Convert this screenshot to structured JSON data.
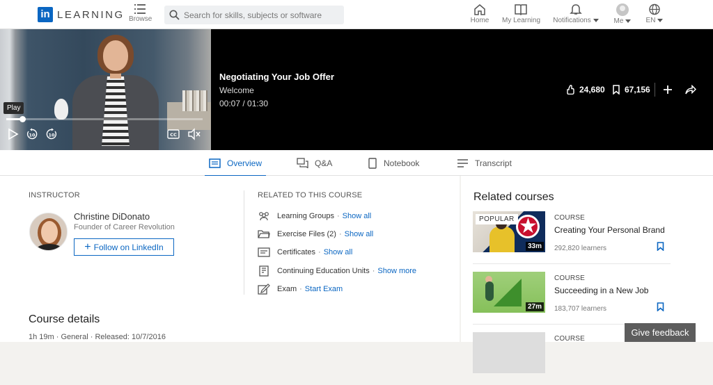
{
  "nav": {
    "logo_mark": "in",
    "logo_text": "LEARNING",
    "browse_label": "Browse",
    "search_placeholder": "Search for skills, subjects or software",
    "items": [
      {
        "label": "Home",
        "icon": "home-icon"
      },
      {
        "label": "My Learning",
        "icon": "book-icon"
      },
      {
        "label": "Notifications",
        "icon": "bell-icon"
      },
      {
        "label": "Me",
        "icon": "avatar"
      },
      {
        "label": "EN",
        "icon": "globe-icon"
      }
    ]
  },
  "player": {
    "tooltip": "Play",
    "progress_fraction": 0.083,
    "title": "Negotiating Your Job Offer",
    "chapter": "Welcome",
    "time": "00:07 / 01:30",
    "likes": "24,680",
    "saves": "67,156",
    "controls": [
      "play-icon",
      "rewind-10-icon",
      "forward-10-icon",
      "captions-icon",
      "mute-icon"
    ]
  },
  "tabs": [
    {
      "label": "Overview",
      "icon": "overview-icon",
      "active": true
    },
    {
      "label": "Q&A",
      "icon": "qa-icon",
      "active": false
    },
    {
      "label": "Notebook",
      "icon": "notebook-icon",
      "active": false
    },
    {
      "label": "Transcript",
      "icon": "transcript-icon",
      "active": false
    }
  ],
  "instructor": {
    "section_label": "INSTRUCTOR",
    "name": "Christine DiDonato",
    "role": "Founder of Career Revolution",
    "follow_label": "Follow on LinkedIn"
  },
  "related": {
    "section_label": "RELATED TO THIS COURSE",
    "rows": [
      {
        "label": "Learning Groups",
        "link": "Show all"
      },
      {
        "label": "Exercise Files (2)",
        "link": "Show all"
      },
      {
        "label": "Certificates",
        "link": "Show all"
      },
      {
        "label": "Continuing Education Units",
        "link": "Show more"
      },
      {
        "label": "Exam",
        "link": "Start Exam"
      }
    ]
  },
  "details": {
    "heading": "Course details",
    "duration": "1h 19m",
    "level": "General",
    "released": "Released: 10/7/2016"
  },
  "related_courses": {
    "heading": "Related courses",
    "items": [
      {
        "kind": "COURSE",
        "title": "Creating Your Personal Brand",
        "learners": "292,820 learners",
        "duration": "33m",
        "badge": "POPULAR"
      },
      {
        "kind": "COURSE",
        "title": "Succeeding in a New Job",
        "learners": "183,707 learners",
        "duration": "27m",
        "badge": ""
      },
      {
        "kind": "COURSE",
        "title": "",
        "learners": "",
        "duration": "",
        "badge": ""
      }
    ]
  },
  "feedback_label": "Give feedback",
  "colors": {
    "accent": "#0a66c2",
    "player_bg": "#000000"
  }
}
